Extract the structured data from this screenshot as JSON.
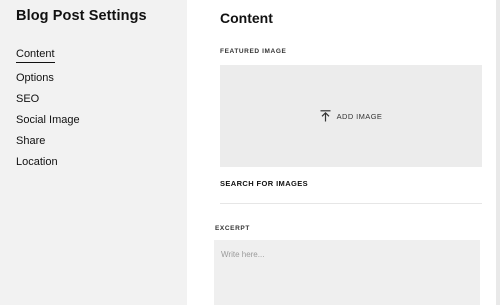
{
  "sidebar": {
    "title": "Blog Post Settings",
    "items": [
      {
        "label": "Content",
        "active": true
      },
      {
        "label": "Options",
        "active": false
      },
      {
        "label": "SEO",
        "active": false
      },
      {
        "label": "Social Image",
        "active": false
      },
      {
        "label": "Share",
        "active": false
      },
      {
        "label": "Location",
        "active": false
      }
    ]
  },
  "main": {
    "title": "Content",
    "featured_image": {
      "label": "FEATURED IMAGE",
      "add_label": "ADD IMAGE",
      "icon": "upload-icon",
      "search_label": "SEARCH FOR IMAGES"
    },
    "excerpt": {
      "label": "EXCERPT",
      "value": "",
      "placeholder": "Write here..."
    }
  },
  "colors": {
    "sidebar_bg": "#f2f2f2",
    "image_box_bg": "#ececec",
    "excerpt_bg": "#efefef",
    "text": "#111111"
  }
}
